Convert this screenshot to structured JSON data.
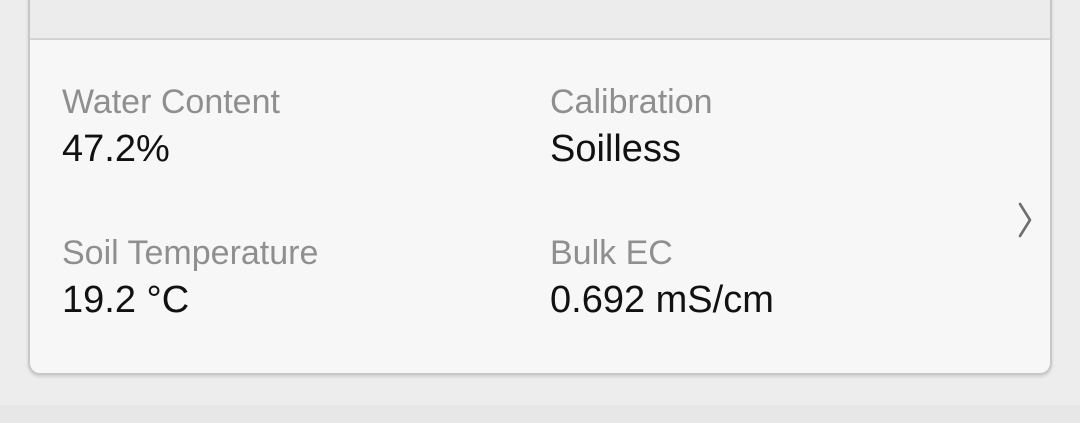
{
  "sensor_card": {
    "fields": {
      "water_content": {
        "label": "Water Content",
        "value": "47.2%"
      },
      "calibration": {
        "label": "Calibration",
        "value": "Soilless"
      },
      "soil_temperature": {
        "label": "Soil Temperature",
        "value": "19.2 °C"
      },
      "bulk_ec": {
        "label": "Bulk EC",
        "value": "0.692 mS/cm"
      }
    },
    "detail_icon": "chevron-right-icon"
  },
  "colors": {
    "background": "#ededed",
    "card_background": "#f7f7f7",
    "card_border": "#c8c8c8",
    "label_text": "#8f8f8f",
    "value_text": "#111111"
  }
}
